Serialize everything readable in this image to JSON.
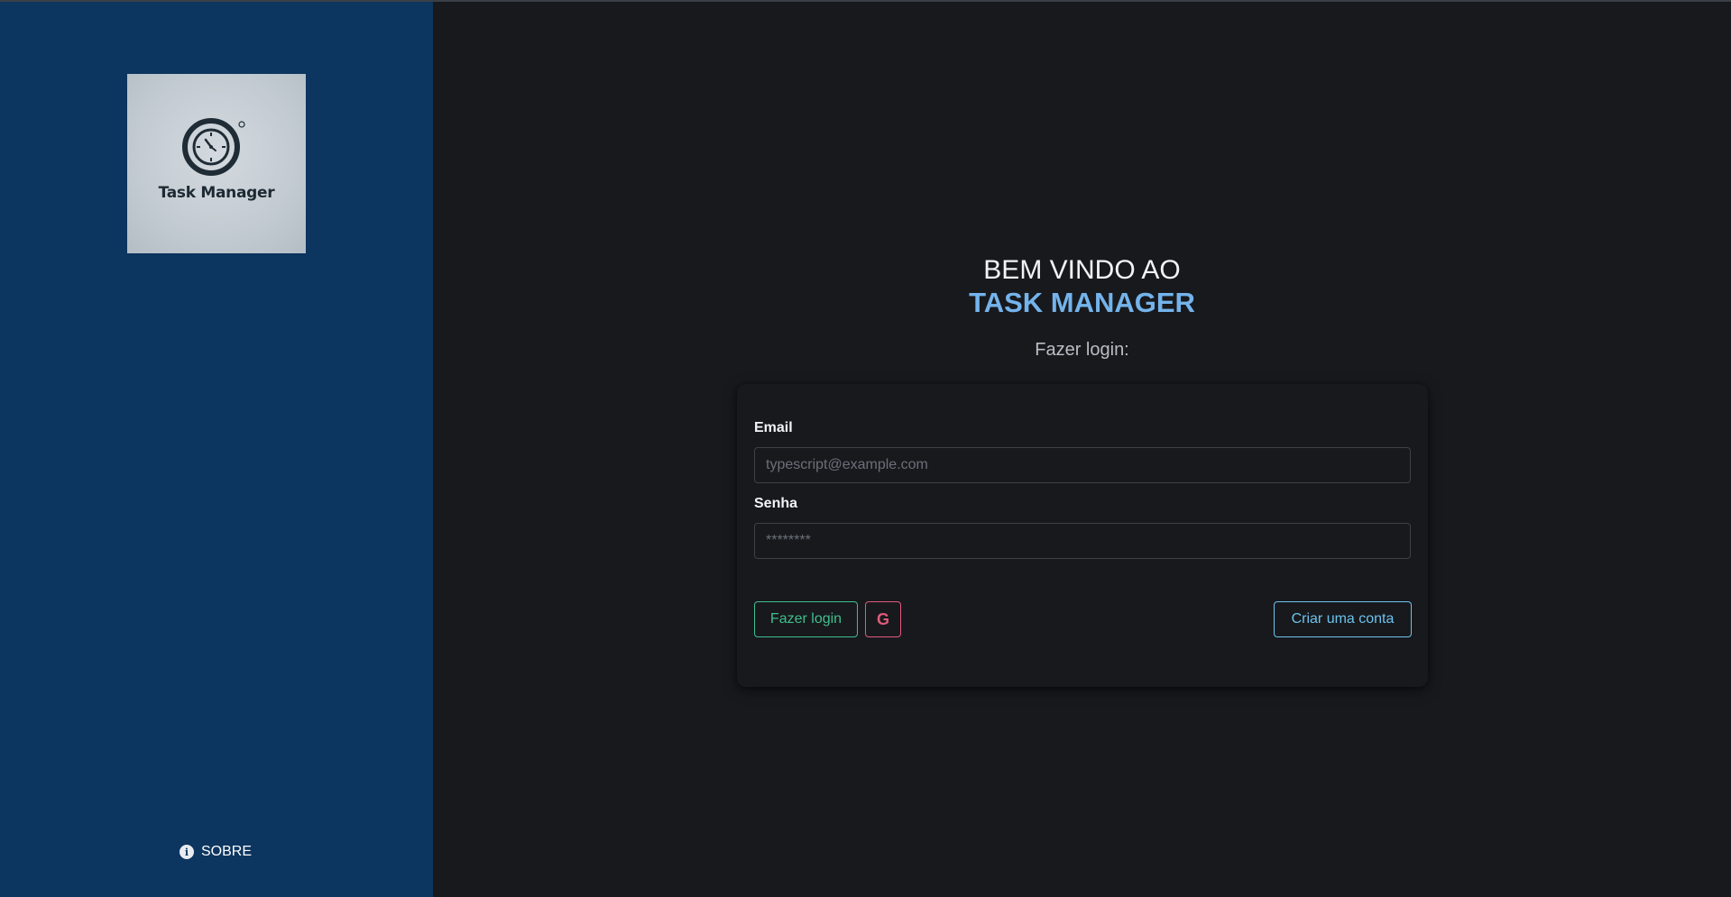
{
  "sidebar": {
    "logo_text": "Task Manager",
    "sobre_label": "SOBRE"
  },
  "main": {
    "welcome": "BEM VINDO AO",
    "brand": "TASK MANAGER",
    "subtitle": "Fazer login:"
  },
  "form": {
    "email_label": "Email",
    "email_placeholder": "typescript@example.com",
    "email_value": "",
    "password_label": "Senha",
    "password_placeholder": "********",
    "password_value": "",
    "login_button": "Fazer login",
    "google_button": "G",
    "create_account_button": "Criar uma conta"
  },
  "icons": {
    "logo": "clock-icon",
    "sobre": "info-icon",
    "google": "google-icon"
  },
  "colors": {
    "sidebar_bg": "#0c355f",
    "brand_accent": "#74b3eb",
    "login_green": "#3fbf8c",
    "google_pink": "#e05a7a",
    "create_blue": "#6cc3ee"
  }
}
